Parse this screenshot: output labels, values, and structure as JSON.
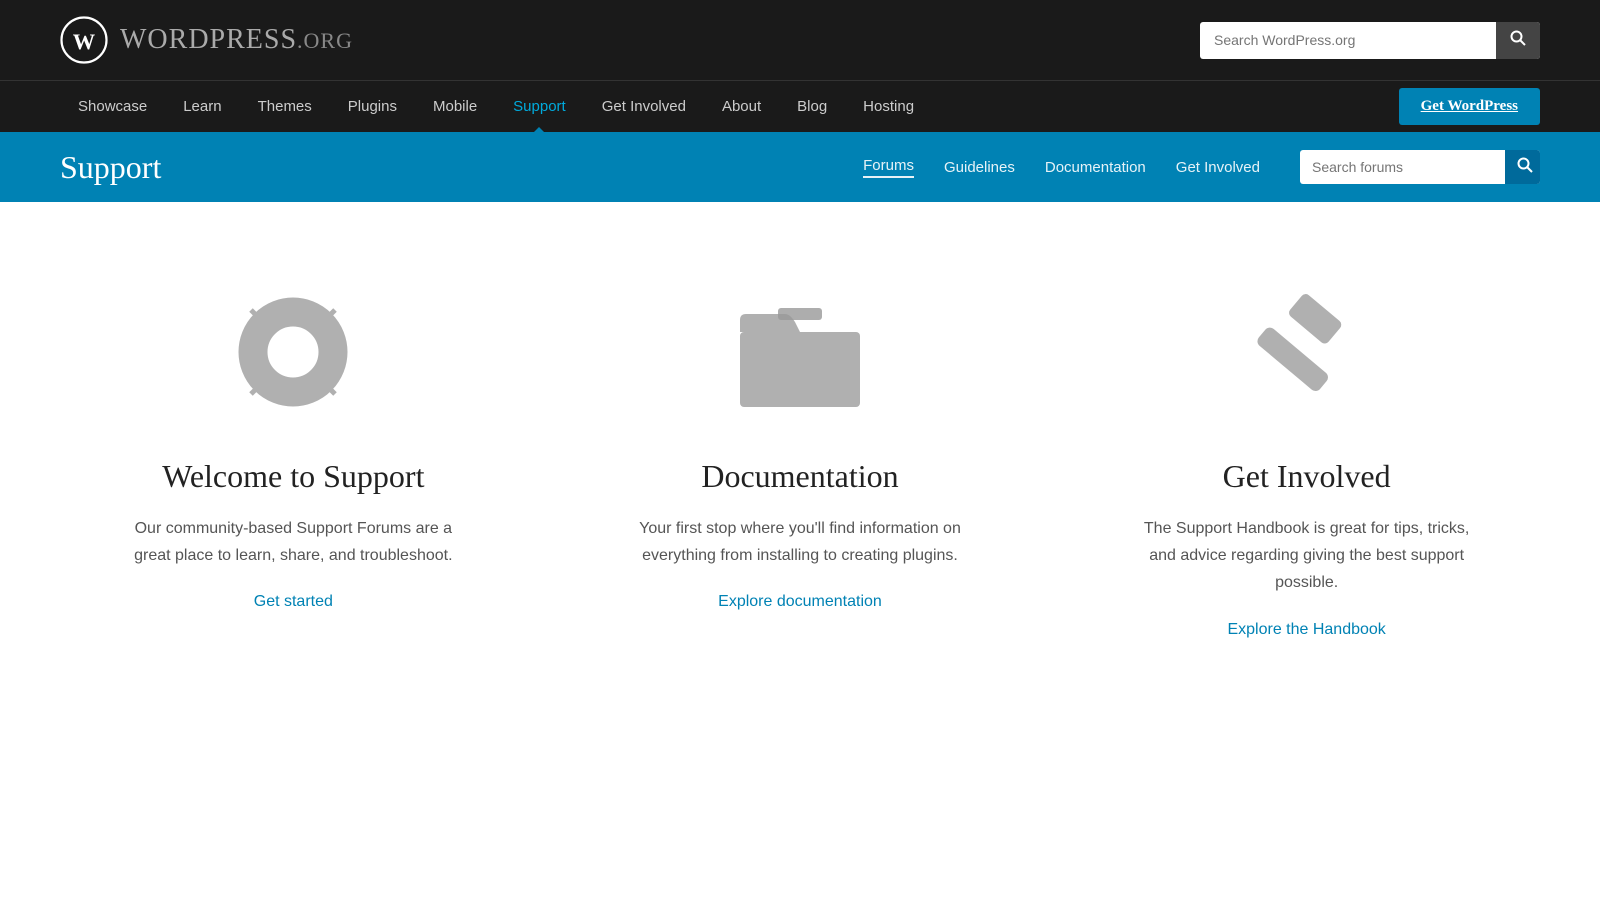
{
  "top_bar": {
    "logo_text": "WordPress",
    "logo_domain": ".org",
    "search_placeholder": "Search WordPress.org",
    "search_button_icon": "🔍"
  },
  "main_nav": {
    "links": [
      {
        "label": "Showcase",
        "active": false
      },
      {
        "label": "Learn",
        "active": false
      },
      {
        "label": "Themes",
        "active": false
      },
      {
        "label": "Plugins",
        "active": false
      },
      {
        "label": "Mobile",
        "active": false
      },
      {
        "label": "Support",
        "active": true
      },
      {
        "label": "Get Involved",
        "active": false
      },
      {
        "label": "About",
        "active": false
      },
      {
        "label": "Blog",
        "active": false
      },
      {
        "label": "Hosting",
        "active": false
      }
    ],
    "cta_button": "Get WordPress"
  },
  "support_bar": {
    "title": "Support",
    "nav_links": [
      {
        "label": "Forums",
        "active": true
      },
      {
        "label": "Guidelines",
        "active": false
      },
      {
        "label": "Documentation",
        "active": false
      },
      {
        "label": "Get Involved",
        "active": false
      }
    ],
    "search_placeholder": "Search forums"
  },
  "cards": [
    {
      "icon": "lifesaver",
      "title": "Welcome to Support",
      "description": "Our community-based Support Forums are a great place to learn, share, and troubleshoot.",
      "link_text": "Get started"
    },
    {
      "icon": "folder",
      "title": "Documentation",
      "description": "Your first stop where you'll find information on everything from installing to creating plugins.",
      "link_text": "Explore documentation"
    },
    {
      "icon": "hammer",
      "title": "Get Involved",
      "description": "The Support Handbook is great for tips, tricks, and advice regarding giving the best support possible.",
      "link_text": "Explore the Handbook"
    }
  ]
}
